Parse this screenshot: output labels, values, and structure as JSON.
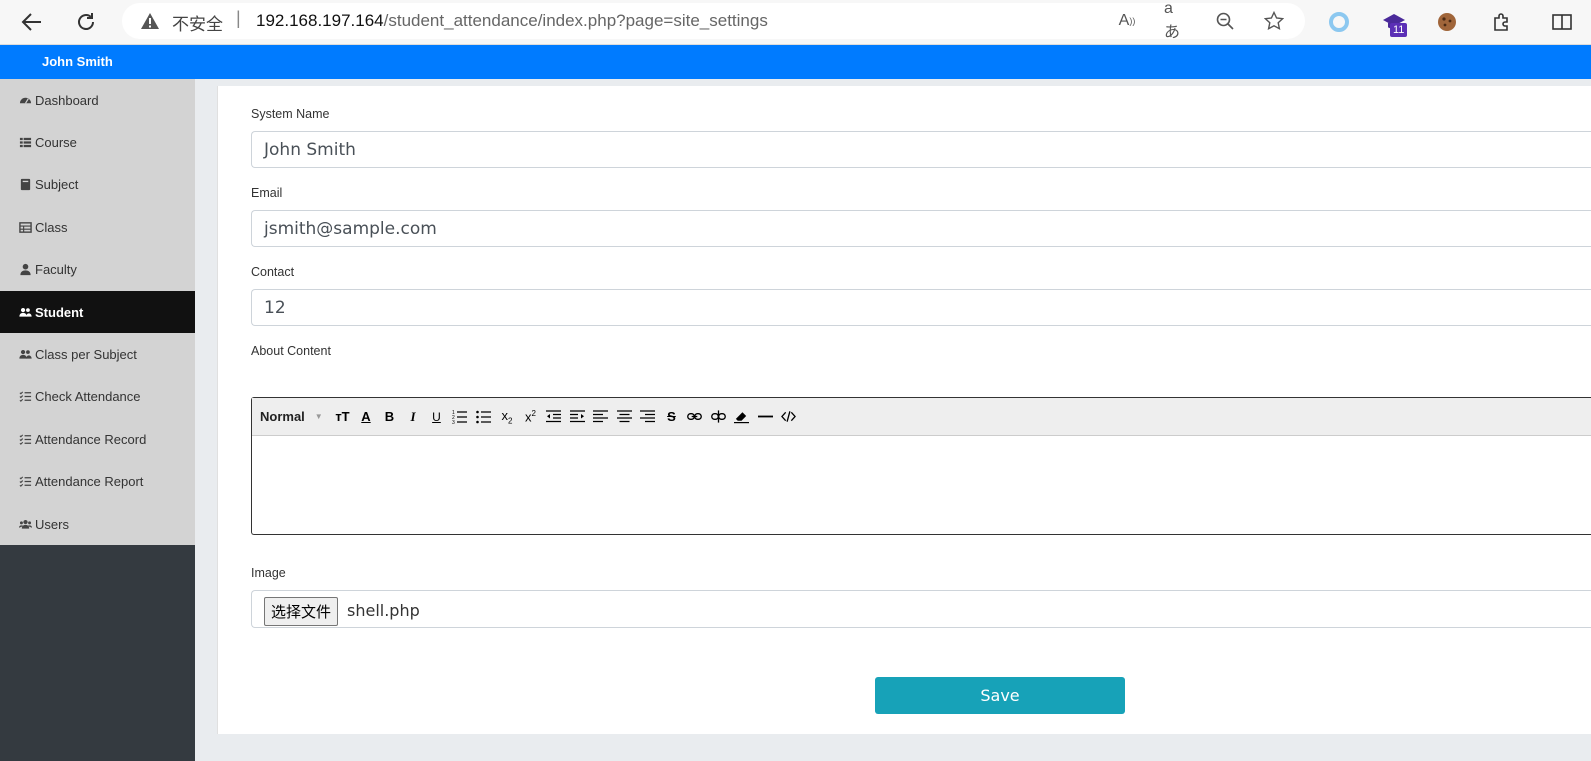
{
  "browser": {
    "insecure_label": "不安全",
    "separator": "|",
    "url_host": "192.168.197.164",
    "url_path": "/student_attendance/index.php?page=site_settings",
    "extension_badge": "11"
  },
  "header": {
    "user_name": "John Smith"
  },
  "sidebar": {
    "items": [
      {
        "label": "Dashboard",
        "icon": "tachometer-icon"
      },
      {
        "label": "Course",
        "icon": "list-icon"
      },
      {
        "label": "Subject",
        "icon": "book-icon"
      },
      {
        "label": "Class",
        "icon": "table-icon"
      },
      {
        "label": "Faculty",
        "icon": "user-tie-icon"
      },
      {
        "label": "Student",
        "icon": "users-icon",
        "active": true
      },
      {
        "label": "Class per Subject",
        "icon": "users-icon"
      },
      {
        "label": "Check Attendance",
        "icon": "tasks-icon"
      },
      {
        "label": "Attendance Record",
        "icon": "tasks-icon"
      },
      {
        "label": "Attendance Report",
        "icon": "tasks-icon"
      },
      {
        "label": "Users",
        "icon": "users-group-icon"
      }
    ]
  },
  "form": {
    "system_name_label": "System Name",
    "system_name_value": "John Smith",
    "email_label": "Email",
    "email_value": "jsmith@sample.com",
    "contact_label": "Contact",
    "contact_value": "12",
    "about_label": "About Content",
    "editor_style": "Normal",
    "image_label": "Image",
    "file_button": "选择文件",
    "file_name": "shell.php",
    "save_label": "Save"
  },
  "colors": {
    "header": "#007bff",
    "save_button": "#17a2b8",
    "sidebar_active": "#111111"
  }
}
